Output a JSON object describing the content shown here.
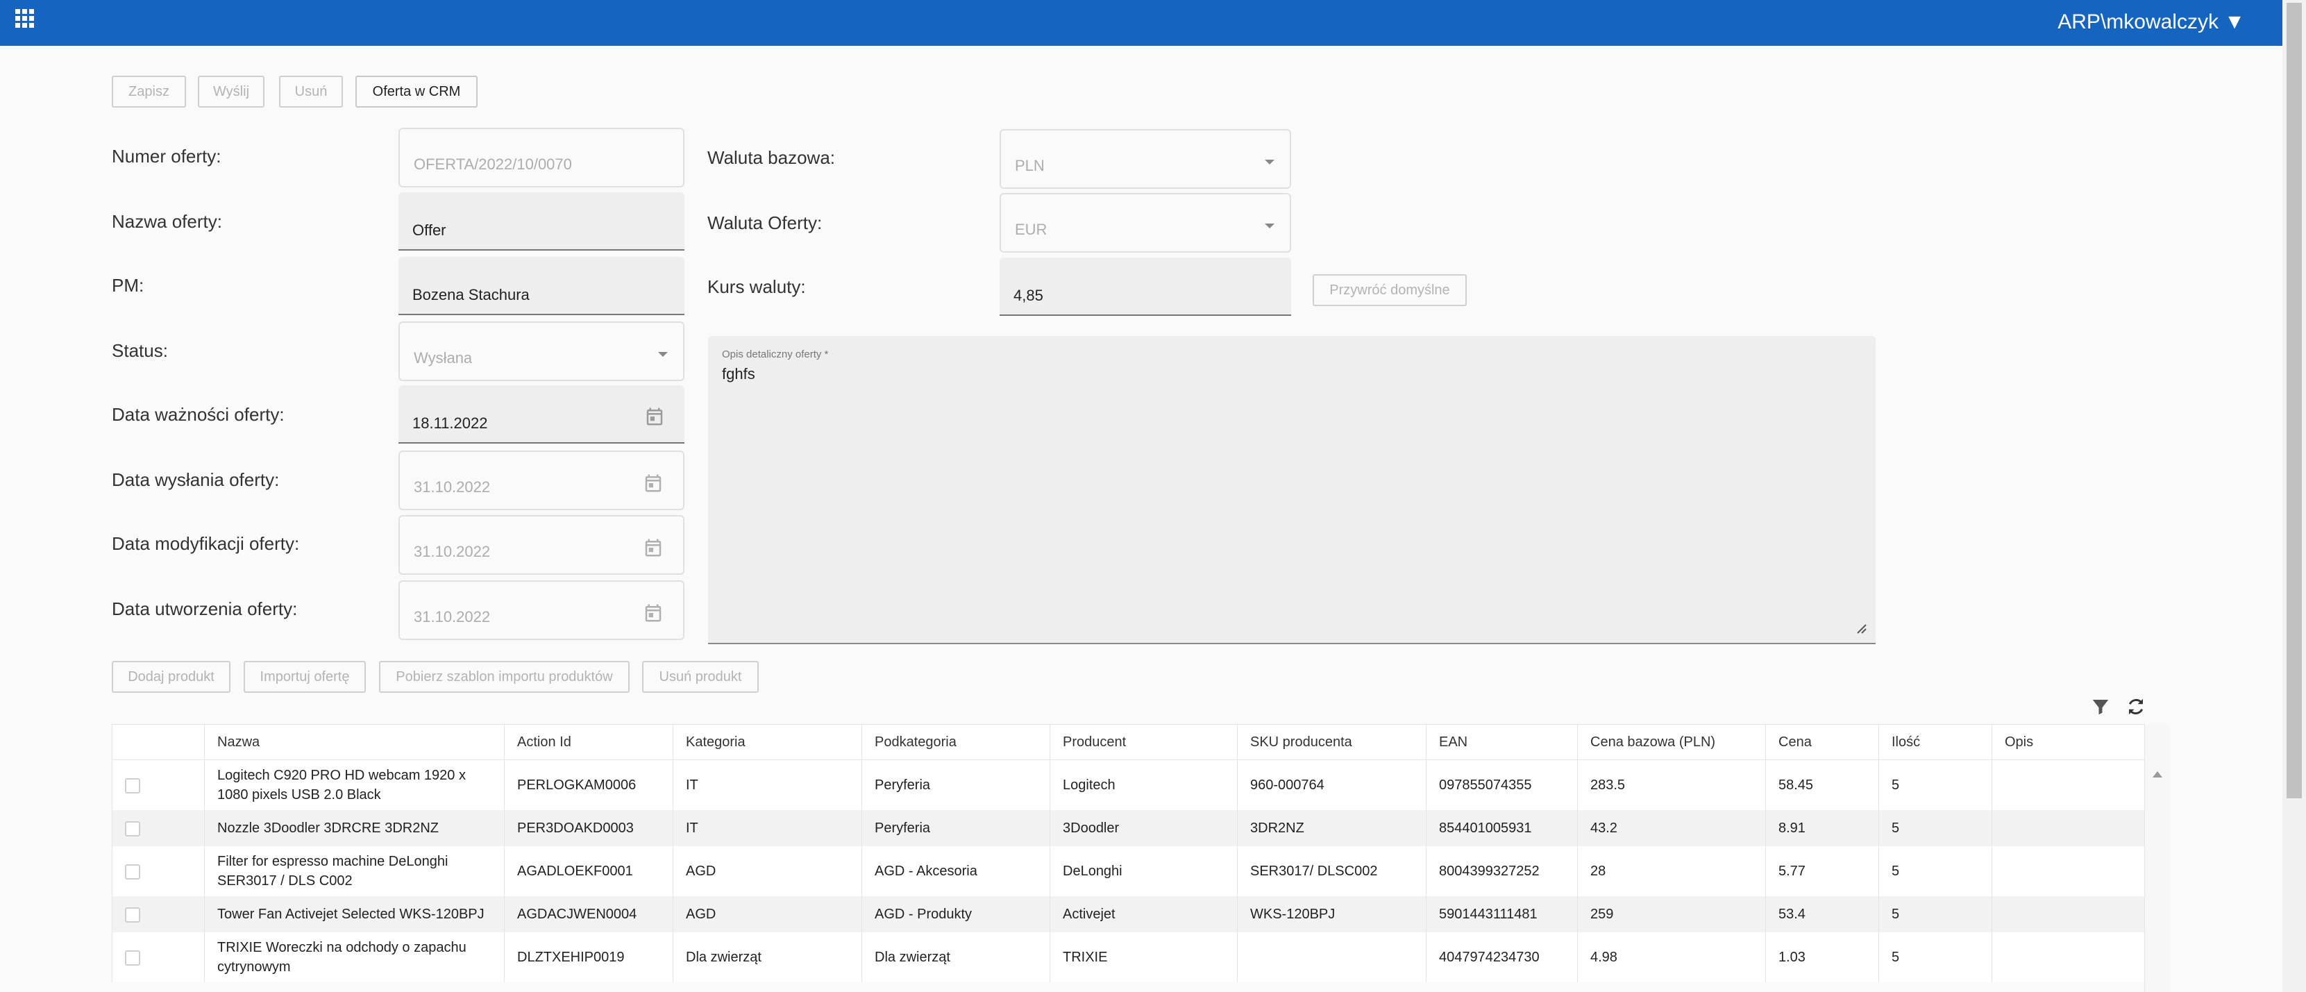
{
  "header": {
    "user": "ARP\\mkowalczyk ▼",
    "apps_icon": "apps-grid-icon"
  },
  "toolbar": {
    "save": "Zapisz",
    "send": "Wyślij",
    "delete": "Usuń",
    "crm": "Oferta w CRM"
  },
  "form": {
    "offer_number": {
      "label": "Numer oferty:",
      "value": "OFERTA/2022/10/0070"
    },
    "offer_name": {
      "label": "Nazwa oferty:",
      "value": "Offer"
    },
    "pm": {
      "label": "PM:",
      "value": "Bozena Stachura"
    },
    "status": {
      "label": "Status:",
      "value": "Wysłana"
    },
    "valid_date": {
      "label": "Data ważności oferty:",
      "value": "18.11.2022"
    },
    "sent_date": {
      "label": "Data wysłania oferty:",
      "value": "31.10.2022"
    },
    "modified_date": {
      "label": "Data modyfikacji oferty:",
      "value": "31.10.2022"
    },
    "created_date": {
      "label": "Data utworzenia oferty:",
      "value": "31.10.2022"
    },
    "base_currency": {
      "label": "Waluta bazowa:",
      "value": "PLN"
    },
    "offer_currency": {
      "label": "Waluta Oferty:",
      "value": "EUR"
    },
    "exchange_rate": {
      "label": "Kurs waluty:",
      "value": "4,85"
    },
    "restore_default": "Przywróć domyślne",
    "description": {
      "label": "Opis detaliczny oferty *",
      "value": "fghfs"
    }
  },
  "product_toolbar": {
    "add": "Dodaj produkt",
    "import": "Importuj ofertę",
    "template": "Pobierz szablon importu produktów",
    "remove": "Usuń produkt"
  },
  "table": {
    "columns": [
      "",
      "Nazwa",
      "Action Id",
      "Kategoria",
      "Podkategoria",
      "Producent",
      "SKU producenta",
      "EAN",
      "Cena bazowa (PLN)",
      "Cena",
      "Ilość",
      "Opis"
    ],
    "rows": [
      {
        "name": "Logitech C920 PRO HD webcam 1920 x 1080 pixels USB 2.0 Black",
        "action_id": "PERLOGKAM0006",
        "category": "IT",
        "subcategory": "Peryferia",
        "producer": "Logitech",
        "sku": "960-000764",
        "ean": "097855074355",
        "base_price": "283.5",
        "price": "58.45",
        "qty": "5",
        "desc": ""
      },
      {
        "name": "Nozzle 3Doodler 3DRCRE 3DR2NZ",
        "action_id": "PER3DOAKD0003",
        "category": "IT",
        "subcategory": "Peryferia",
        "producer": "3Doodler",
        "sku": "3DR2NZ",
        "ean": "854401005931",
        "base_price": "43.2",
        "price": "8.91",
        "qty": "5",
        "desc": ""
      },
      {
        "name": "Filter for espresso machine DeLonghi SER3017 / DLS C002",
        "action_id": "AGADLOEKF0001",
        "category": "AGD",
        "subcategory": "AGD - Akcesoria",
        "producer": "DeLonghi",
        "sku": "SER3017/ DLSC002",
        "ean": "8004399327252",
        "base_price": "28",
        "price": "5.77",
        "qty": "5",
        "desc": ""
      },
      {
        "name": "Tower Fan Activejet Selected WKS-120BPJ",
        "action_id": "AGDACJWEN0004",
        "category": "AGD",
        "subcategory": "AGD - Produkty",
        "producer": "Activejet",
        "sku": "WKS-120BPJ",
        "ean": "5901443111481",
        "base_price": "259",
        "price": "53.4",
        "qty": "5",
        "desc": ""
      },
      {
        "name": "TRIXIE Woreczki na odchody o zapachu cytrynowym",
        "action_id": "DLZTXEHIP0019",
        "category": "Dla zwierząt",
        "subcategory": "Dla zwierząt",
        "producer": "TRIXIE",
        "sku": "",
        "ean": "4047974234730",
        "base_price": "4.98",
        "price": "1.03",
        "qty": "5",
        "desc": ""
      }
    ]
  }
}
